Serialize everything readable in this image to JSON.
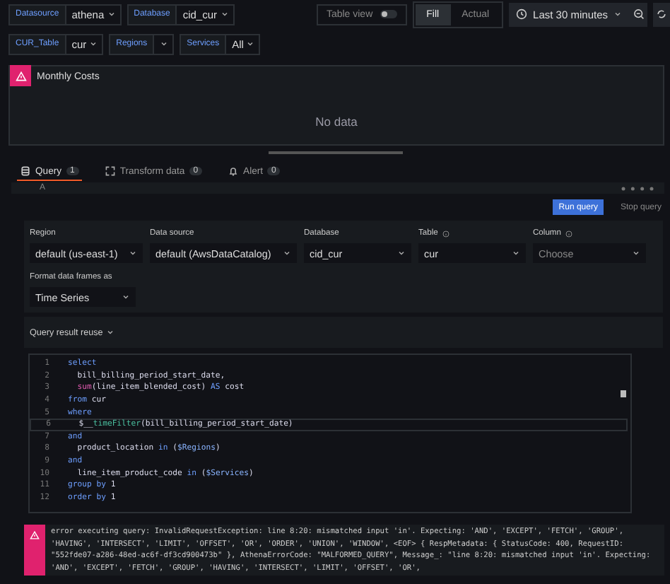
{
  "variables": [
    {
      "label": "Datasource",
      "value": "athena"
    },
    {
      "label": "Database",
      "value": "cid_cur"
    }
  ],
  "variables_row2": [
    {
      "label": "CUR_Table",
      "value": "cur"
    },
    {
      "label": "Regions"
    },
    {
      "label": "Services",
      "value": "All"
    }
  ],
  "table_view": {
    "label": "Table view",
    "on": false
  },
  "fill_modes": [
    {
      "label": "Fill",
      "selected": true
    },
    {
      "label": "Actual",
      "selected": false
    }
  ],
  "time_range": "Last 30 minutes",
  "panel": {
    "title": "Monthly Costs",
    "message": "No data"
  },
  "tabs": [
    {
      "label": "Query",
      "count": "1",
      "selected": true
    },
    {
      "label": "Transform data",
      "count": "0",
      "selected": false
    },
    {
      "label": "Alert",
      "count": "0",
      "selected": false
    }
  ],
  "query_row": {
    "ref": "A"
  },
  "buttons": {
    "run": "Run query",
    "stop": "Stop query"
  },
  "form": [
    {
      "label": "Region",
      "value": "default (us-east-1)",
      "info": false,
      "placeholder": false
    },
    {
      "label": "Data source",
      "value": "default (AwsDataCatalog)",
      "info": false,
      "placeholder": false
    },
    {
      "label": "Database",
      "value": "cid_cur",
      "info": false,
      "placeholder": false
    },
    {
      "label": "Table",
      "value": "cur",
      "info": true,
      "placeholder": false
    },
    {
      "label": "Column",
      "value": "Choose",
      "info": true,
      "placeholder": true
    }
  ],
  "format": {
    "label": "Format data frames as",
    "value": "Time Series"
  },
  "reuse": "Query result reuse",
  "code": [
    {
      "num": "1",
      "tokens": [
        {
          "kind": "keyword",
          "text": "select"
        }
      ]
    },
    {
      "num": "2",
      "tokens": [
        {
          "kind": "ident",
          "text": "  bill_billing_period_start_date,"
        }
      ]
    },
    {
      "num": "3",
      "tokens": [
        {
          "kind": "func",
          "text": "  sum"
        },
        {
          "kind": "ident",
          "text": "(line_item_blended_cost) "
        },
        {
          "kind": "keyword",
          "text": "AS"
        },
        {
          "kind": "ident",
          "text": " cost"
        }
      ]
    },
    {
      "num": "4",
      "tokens": [
        {
          "kind": "keyword",
          "text": "from"
        },
        {
          "kind": "ident",
          "text": " cur"
        }
      ]
    },
    {
      "num": "5",
      "tokens": [
        {
          "kind": "keyword",
          "text": "where"
        }
      ]
    },
    {
      "num": "6",
      "tokens": [
        {
          "kind": "ident",
          "text": "  $__"
        },
        {
          "kind": "macro",
          "text": "timeFilter"
        },
        {
          "kind": "ident",
          "text": "(bill_billing_period_start_date)"
        }
      ]
    },
    {
      "num": "7",
      "tokens": [
        {
          "kind": "keyword",
          "text": "and"
        }
      ]
    },
    {
      "num": "8",
      "tokens": [
        {
          "kind": "ident",
          "text": "  product_location "
        },
        {
          "kind": "keyword",
          "text": "in"
        },
        {
          "kind": "ident",
          "text": " ("
        },
        {
          "kind": "var",
          "text": "$Regions"
        },
        {
          "kind": "ident",
          "text": ")"
        }
      ]
    },
    {
      "num": "9",
      "tokens": [
        {
          "kind": "keyword",
          "text": "and"
        }
      ]
    },
    {
      "num": "10",
      "tokens": [
        {
          "kind": "ident",
          "text": "  line_item_product_code "
        },
        {
          "kind": "keyword",
          "text": "in"
        },
        {
          "kind": "ident",
          "text": " ("
        },
        {
          "kind": "var",
          "text": "$Services"
        },
        {
          "kind": "ident",
          "text": ")"
        }
      ]
    },
    {
      "num": "11",
      "tokens": [
        {
          "kind": "keyword",
          "text": "group by"
        },
        {
          "kind": "ident",
          "text": " 1"
        }
      ]
    },
    {
      "num": "12",
      "tokens": [
        {
          "kind": "keyword",
          "text": "order by"
        },
        {
          "kind": "ident",
          "text": " 1"
        }
      ]
    }
  ],
  "error": "error executing query: InvalidRequestException: line 8:20: mismatched input 'in'. Expecting: 'AND', 'EXCEPT', 'FETCH', 'GROUP', 'HAVING', 'INTERSECT', 'LIMIT', 'OFFSET', 'OR', 'ORDER', 'UNION', 'WINDOW', <EOF> { RespMetadata: { StatusCode: 400, RequestID: \"552fde07-a286-48ed-ac6f-df3cd900473b\" }, AthenaErrorCode: \"MALFORMED_QUERY\", Message_: \"line 8:20: mismatched input 'in'. Expecting: 'AND', 'EXCEPT', 'FETCH', 'GROUP', 'HAVING', 'INTERSECT', 'LIMIT', 'OFFSET', 'OR',"
}
